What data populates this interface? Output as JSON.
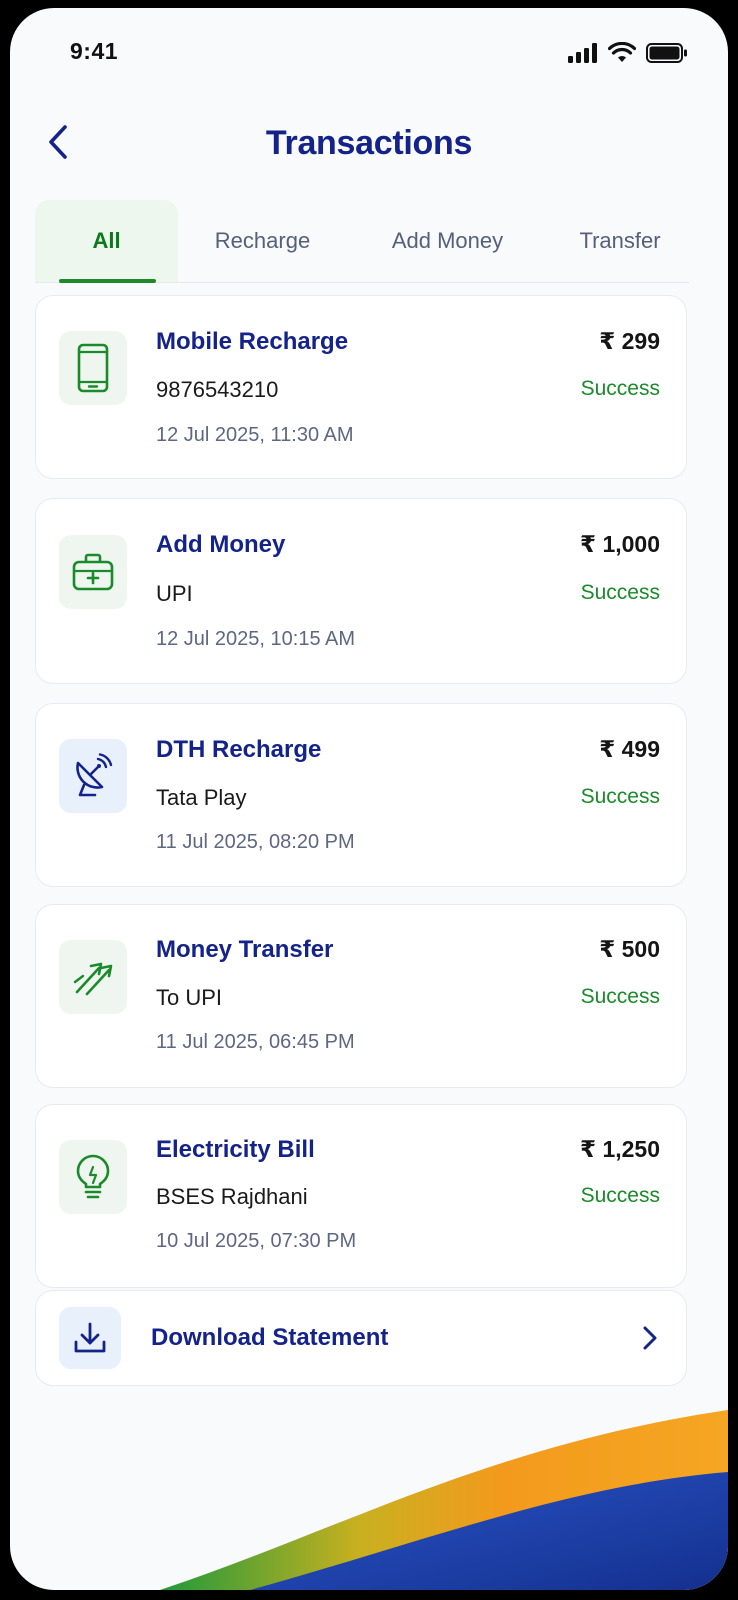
{
  "status_bar": {
    "time": "9:41"
  },
  "header": {
    "title": "Transactions"
  },
  "tabs": [
    {
      "label": "All",
      "active": true
    },
    {
      "label": "Recharge",
      "active": false
    },
    {
      "label": "Add Money",
      "active": false
    },
    {
      "label": "Transfer",
      "active": false
    }
  ],
  "transactions": [
    {
      "icon": "mobile-icon",
      "title": "Mobile Recharge",
      "subtitle": "9876543210",
      "date": "12 Jul 2025, 11:30 AM",
      "amount": "₹ 299",
      "status": "Success"
    },
    {
      "icon": "wallet-icon",
      "title": "Add Money",
      "subtitle": "UPI",
      "date": "12 Jul 2025, 10:15 AM",
      "amount": "₹ 1,000",
      "status": "Success"
    },
    {
      "icon": "satellite-dish-icon",
      "title": "DTH Recharge",
      "subtitle": "Tata Play",
      "date": "11 Jul 2025, 08:20 PM",
      "amount": "₹ 499",
      "status": "Success"
    },
    {
      "icon": "transfer-arrows-icon",
      "title": "Money Transfer",
      "subtitle": "To UPI",
      "date": "11 Jul 2025, 06:45 PM",
      "amount": "₹ 500",
      "status": "Success"
    },
    {
      "icon": "lightbulb-icon",
      "title": "Electricity Bill",
      "subtitle": "BSES Rajdhani",
      "date": "10 Jul 2025, 07:30 PM",
      "amount": "₹ 1,250",
      "status": "Success"
    }
  ],
  "download": {
    "label": "Download Statement",
    "icon": "download-icon"
  },
  "colors": {
    "primary": "#14238a",
    "success": "#1a8a2a",
    "saffron": "#f39a1c",
    "india_green": "#1e9a3a",
    "deep_blue": "#1b3fa8"
  }
}
